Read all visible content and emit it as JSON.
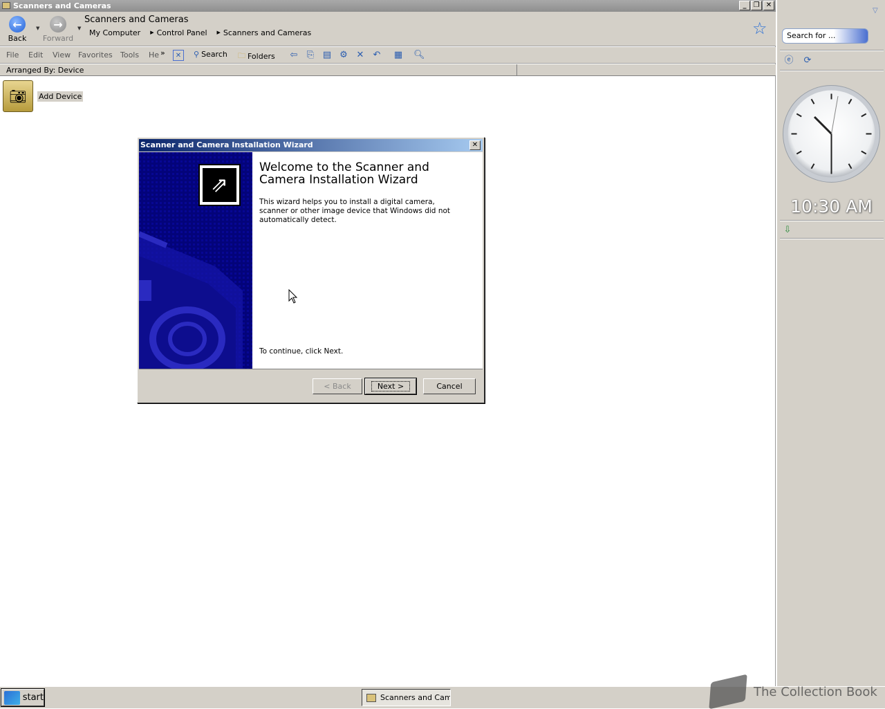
{
  "window": {
    "title": "Scanners and Cameras"
  },
  "nav": {
    "back_label": "Back",
    "forward_label": "Forward",
    "address_title": "Scanners and Cameras",
    "breadcrumbs": [
      "My Computer",
      "Control Panel",
      "Scanners and Cameras"
    ]
  },
  "menu": [
    "File",
    "Edit",
    "View",
    "Favorites",
    "Tools",
    "He"
  ],
  "toolbar": {
    "search_label": "Search",
    "folders_label": "Folders",
    "more": "»"
  },
  "status": {
    "arranged_by": "Arranged By: Device"
  },
  "content": {
    "add_device_label": "Add Device"
  },
  "wizard": {
    "title": "Scanner and Camera Installation Wizard",
    "heading": "Welcome to the Scanner and Camera Installation Wizard",
    "description": "This wizard helps you to install a digital camera, scanner or other image device that Windows did not automatically detect.",
    "continue_text": "To continue, click Next.",
    "back_label": "< Back",
    "next_label": "Next >",
    "cancel_label": "Cancel",
    "close_glyph": "✕"
  },
  "sidebar": {
    "search_placeholder": "Search for ...",
    "clock_time": "10:30 AM"
  },
  "taskbar": {
    "start_label": "start",
    "task_label": "Scanners and Came"
  },
  "watermark": {
    "text": "The Collection Book"
  },
  "colors": {
    "dialog_title": "#0a246a",
    "side_panel": "#03037a",
    "face": "#d4d0c8"
  },
  "icons": [
    "back-arrow-icon",
    "forward-arrow-icon",
    "star-icon",
    "search-icon",
    "folders-icon",
    "close-icon",
    "clock-icon"
  ]
}
